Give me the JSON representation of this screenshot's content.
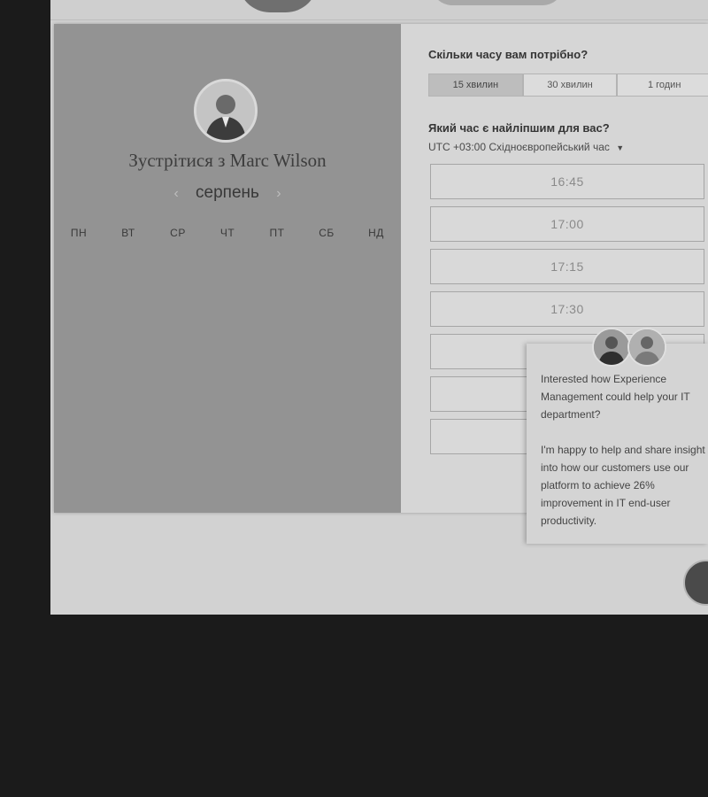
{
  "booking": {
    "meet_title": "Зустрітися з Marc Wilson",
    "month": "серпень",
    "prev_arrow": "‹",
    "next_arrow": "›",
    "weekdays": [
      "ПН",
      "ВТ",
      "СР",
      "ЧТ",
      "ПТ",
      "СБ",
      "НД"
    ]
  },
  "duration": {
    "question": "Скільки часу вам потрібно?",
    "options": [
      "15 хвилин",
      "30 хвилин",
      "1 годин"
    ],
    "selected": "15 хвилин"
  },
  "time": {
    "question": "Який час є найліпшим для вас?",
    "timezone": "UTC +03:00 Східноєвропейський час",
    "slots": [
      "16:45",
      "17:00",
      "17:15",
      "17:30"
    ]
  },
  "chat": {
    "message_1": "Interested how Experience Management could help your IT department?",
    "message_2": "I'm happy to help and share insight into how our customers use our platform to achieve 26% improvement in IT end-user productivity."
  },
  "colors": {
    "page_background": "#1b1b1b",
    "left_panel": "#939393",
    "right_panel": "#d6d6d6"
  }
}
